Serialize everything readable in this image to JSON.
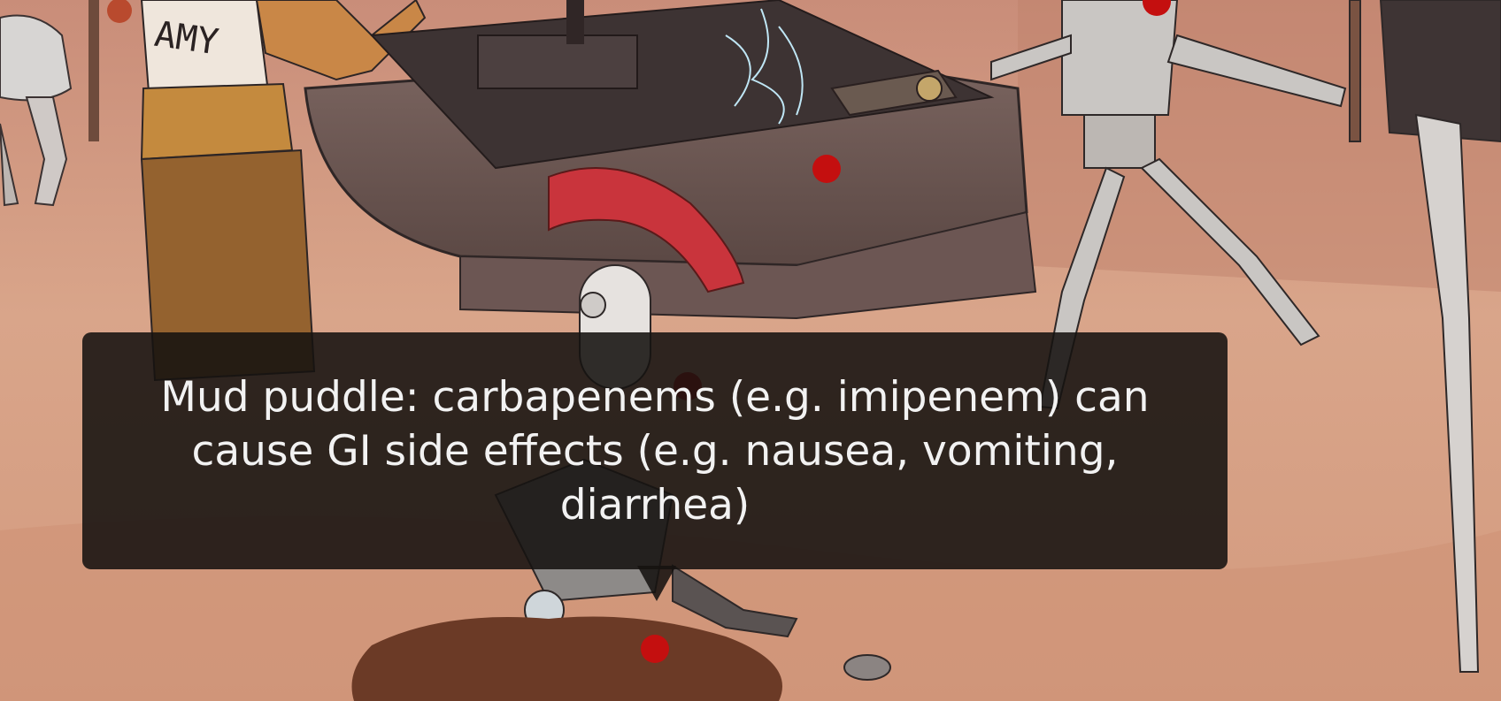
{
  "scene": {
    "shirt_lettering": "AMY",
    "colors": {
      "background_sand": "#d9a98e",
      "hotspot": "#c40f0f",
      "tooltip_bg": "#161210",
      "tooltip_text": "#f2f2f2",
      "crest": "#c9343c",
      "mud": "#6b3a26"
    }
  },
  "tooltip": {
    "text": "Mud puddle: carbapenems (e.g. imipenem) can cause GI side effects (e.g. nausea, vomiting, diarrhea)"
  },
  "hotspots": [
    {
      "name": "top-right-hotspot"
    },
    {
      "name": "machine-hotspot"
    },
    {
      "name": "robot-body-hotspot"
    },
    {
      "name": "mud-puddle-hotspot"
    }
  ]
}
